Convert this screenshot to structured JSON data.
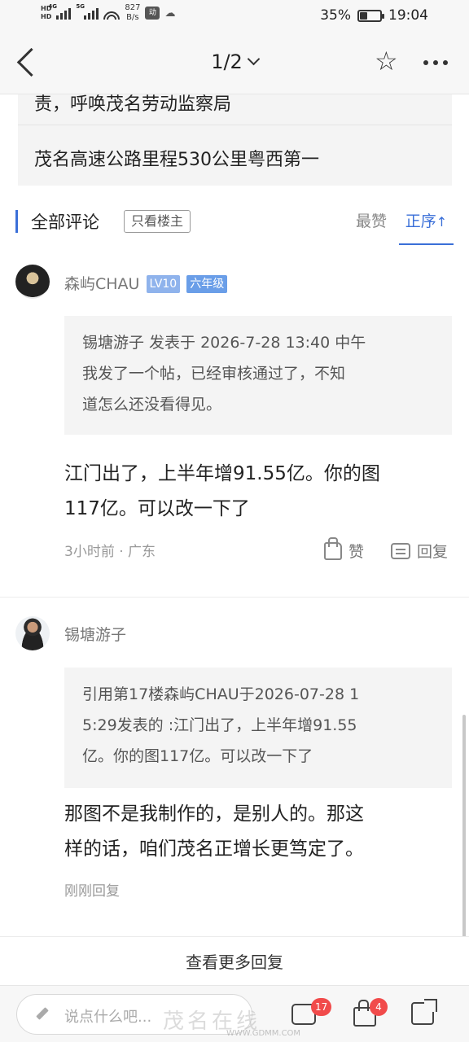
{
  "status_bar": {
    "hd1": "HD",
    "hd2": "HD",
    "net1": "4G",
    "net2": "5G",
    "speed_value": "827",
    "speed_unit": "B/s",
    "app_icon_text": "动",
    "battery_percent": "35%",
    "battery_level": 0.35,
    "time": "19:04"
  },
  "navbar": {
    "pager": "1/2"
  },
  "snippet": {
    "line1": "责，呼唤茂名劳动监察局",
    "line2": "茂名高速公路里程530公里粤西第一"
  },
  "comments_header": {
    "title": "全部评论",
    "filter": "只看楼主",
    "sort_hot": "最赞",
    "sort_asc": "正序",
    "sort_arrow": "↑"
  },
  "comments": [
    {
      "username": "森屿CHAU",
      "level_badge": "LV10",
      "grade_badge": "六年级",
      "quote_lines": [
        "锡塘游子 发表于 2026-7-28 13:40 中午",
        "我发了一个帖，已经审核通过了，不知",
        "道怎么还没看得见。"
      ],
      "body_lines": [
        "江门出了，上半年增91.55亿。你的图",
        "117亿。可以改一下了"
      ],
      "meta": "3小时前 · 广东",
      "like_label": "赞",
      "reply_label": "回复"
    },
    {
      "username": "锡塘游子",
      "quote_lines": [
        "引用第17楼森屿CHAU于2026-07-28 1",
        "5:29发表的  :江门出了，上半年增91.55",
        "亿。你的图117亿。可以改一下了"
      ],
      "body_lines": [
        "那图不是我制作的，是别人的。那这",
        "样的话，咱们茂名正增长更笃定了。"
      ],
      "meta": "刚刚回复"
    }
  ],
  "more_replies": "查看更多回复",
  "bottom_bar": {
    "input_placeholder": "说点什么吧...",
    "comment_count": "17",
    "like_count": "4"
  },
  "watermark": {
    "main": "茂名在线",
    "sub": "WWW.GDMM.COM"
  }
}
